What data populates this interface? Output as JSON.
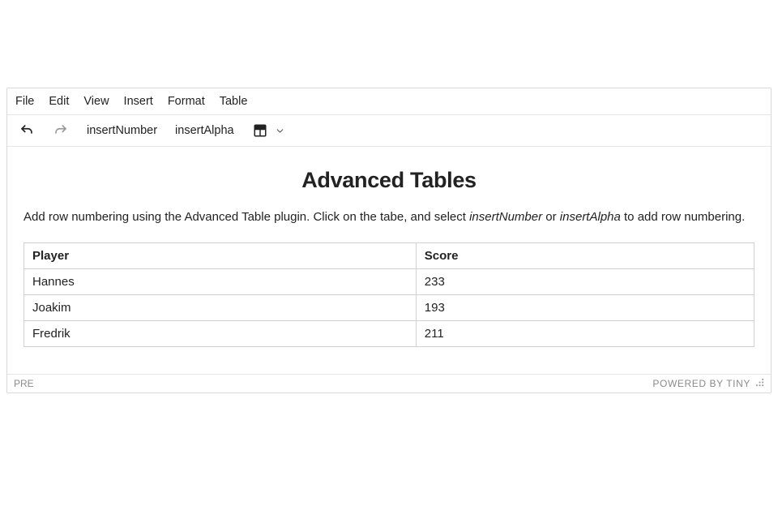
{
  "menubar": {
    "items": [
      {
        "label": "File"
      },
      {
        "label": "Edit"
      },
      {
        "label": "View"
      },
      {
        "label": "Insert"
      },
      {
        "label": "Format"
      },
      {
        "label": "Table"
      }
    ]
  },
  "toolbar": {
    "undo_tooltip": "Undo",
    "redo_tooltip": "Redo",
    "insertNumber_label": "insertNumber",
    "insertAlpha_label": "insertAlpha"
  },
  "content": {
    "heading": "Advanced Tables",
    "intro_parts": {
      "p1": "Add row numbering using the Advanced Table plugin. Click on the tabe, and select ",
      "em1": "insertNumber",
      "p2": " or ",
      "em2": "insertAlpha",
      "p3": " to add row numbering."
    },
    "table": {
      "headers": [
        "Player",
        "Score"
      ],
      "rows": [
        {
          "player": "Hannes",
          "score": "233"
        },
        {
          "player": "Joakim",
          "score": "193"
        },
        {
          "player": "Fredrik",
          "score": "211"
        }
      ]
    }
  },
  "statusbar": {
    "path": "PRE",
    "branding": "POWERED BY TINY"
  }
}
